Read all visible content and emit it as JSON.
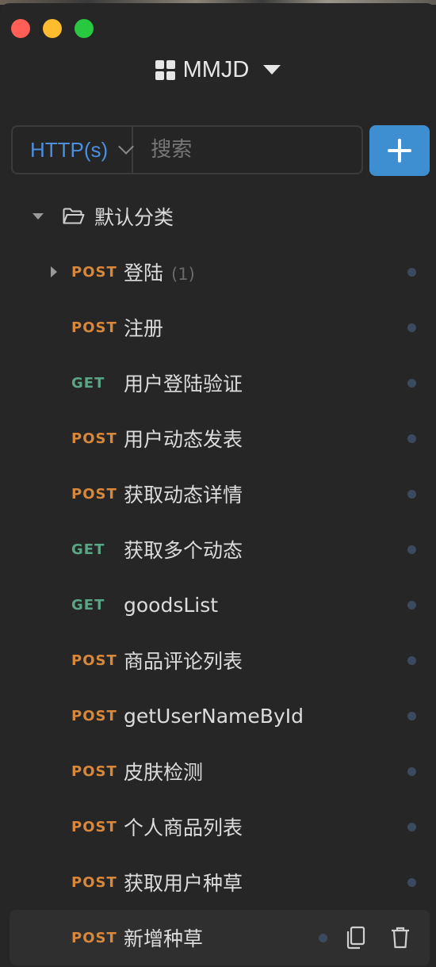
{
  "project": {
    "name": "MMJD"
  },
  "toolbar": {
    "protocol": "HTTP(s)",
    "search_placeholder": "搜索"
  },
  "folder": {
    "label": "默认分类"
  },
  "requests": [
    {
      "method": "POST",
      "name": "登陆",
      "count": "(1)",
      "expandable": true
    },
    {
      "method": "POST",
      "name": "注册"
    },
    {
      "method": "GET",
      "name": "用户登陆验证"
    },
    {
      "method": "POST",
      "name": "用户动态发表"
    },
    {
      "method": "POST",
      "name": "获取动态详情"
    },
    {
      "method": "GET",
      "name": "获取多个动态"
    },
    {
      "method": "GET",
      "name": "goodsList"
    },
    {
      "method": "POST",
      "name": "商品评论列表"
    },
    {
      "method": "POST",
      "name": "getUserNameById"
    },
    {
      "method": "POST",
      "name": "皮肤检测"
    },
    {
      "method": "POST",
      "name": "个人商品列表"
    },
    {
      "method": "POST",
      "name": "获取用户种草"
    },
    {
      "method": "POST",
      "name": "新增种草",
      "active": true
    }
  ],
  "colors": {
    "post": "#d9883b",
    "get": "#5aa585",
    "accent": "#3d8fd1",
    "protocol_text": "#4a8fe0"
  },
  "icons": {
    "add": "plus-icon",
    "copy": "copy-icon",
    "delete": "trash-icon",
    "folder": "folder-open-icon"
  }
}
